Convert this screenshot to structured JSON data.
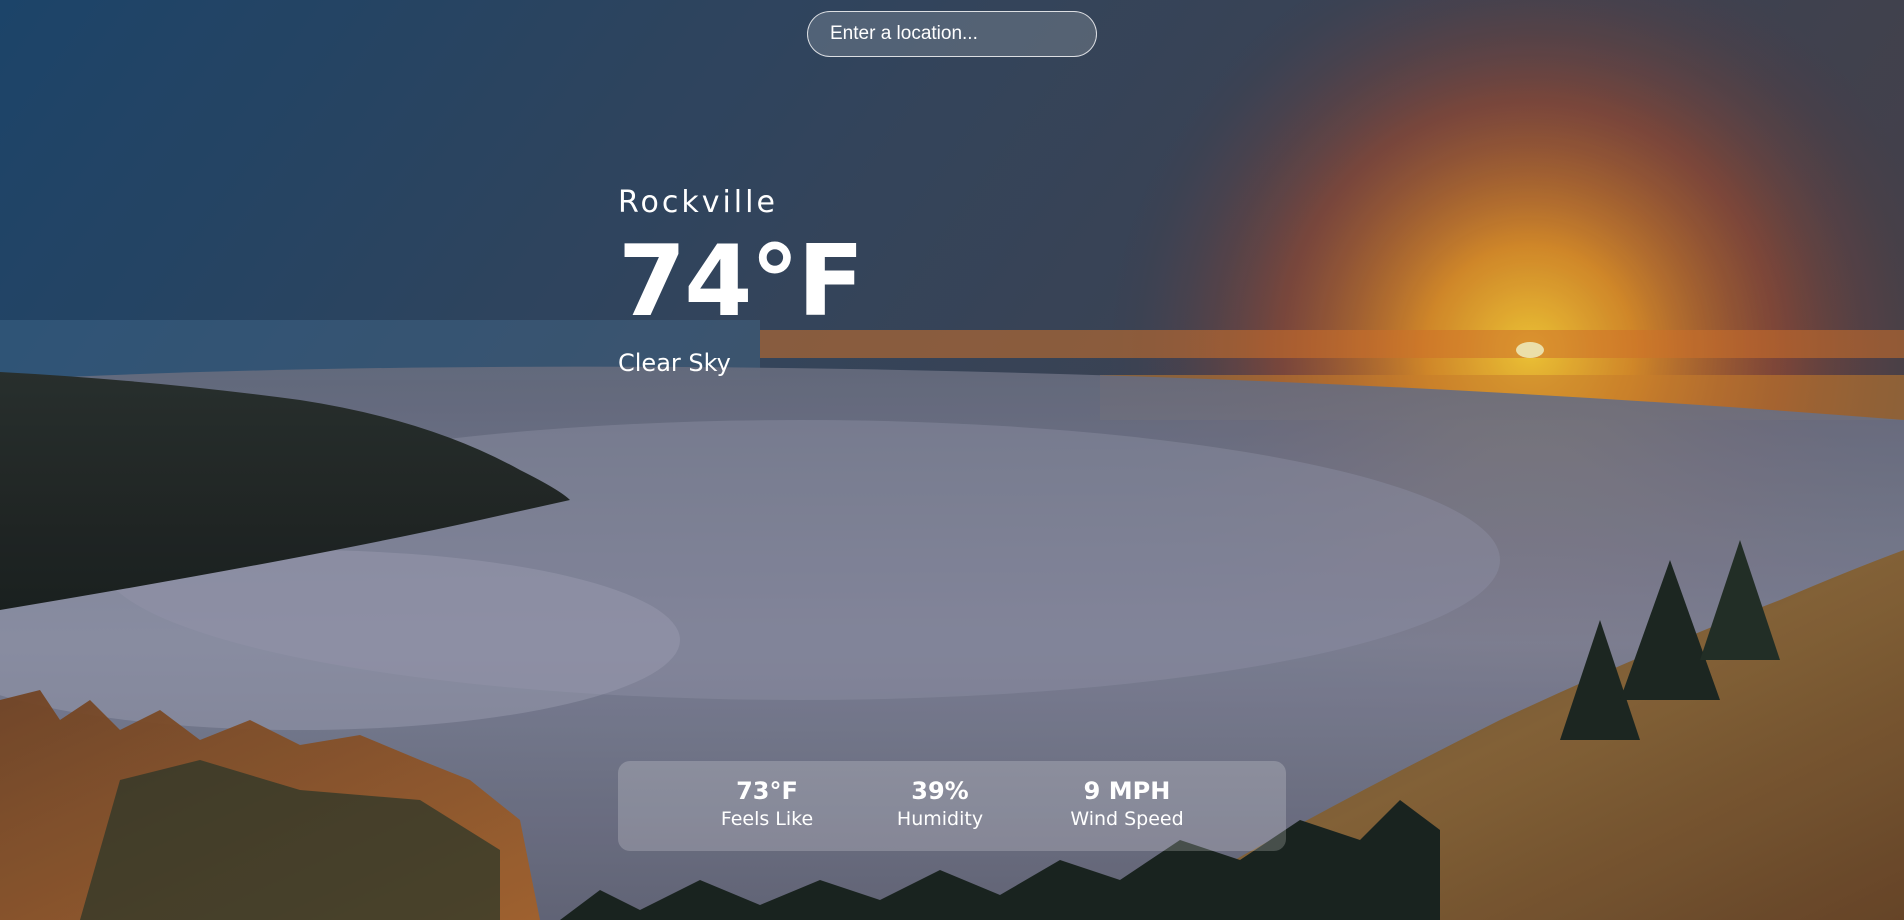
{
  "search": {
    "placeholder": "Enter a location..."
  },
  "current": {
    "city": "Rockville",
    "temperature": "74°F",
    "description": "Clear Sky"
  },
  "details": [
    {
      "value": "73°F",
      "label": "Feels Like"
    },
    {
      "value": "39%",
      "label": "Humidity"
    },
    {
      "value": "9 MPH",
      "label": "Wind Speed"
    }
  ],
  "colors": {
    "text": "#ffffff",
    "sky_top": "#21496f",
    "sunset": "#f29a28",
    "fog": "#8a8ea4",
    "hillside": "#8e6a3c"
  }
}
